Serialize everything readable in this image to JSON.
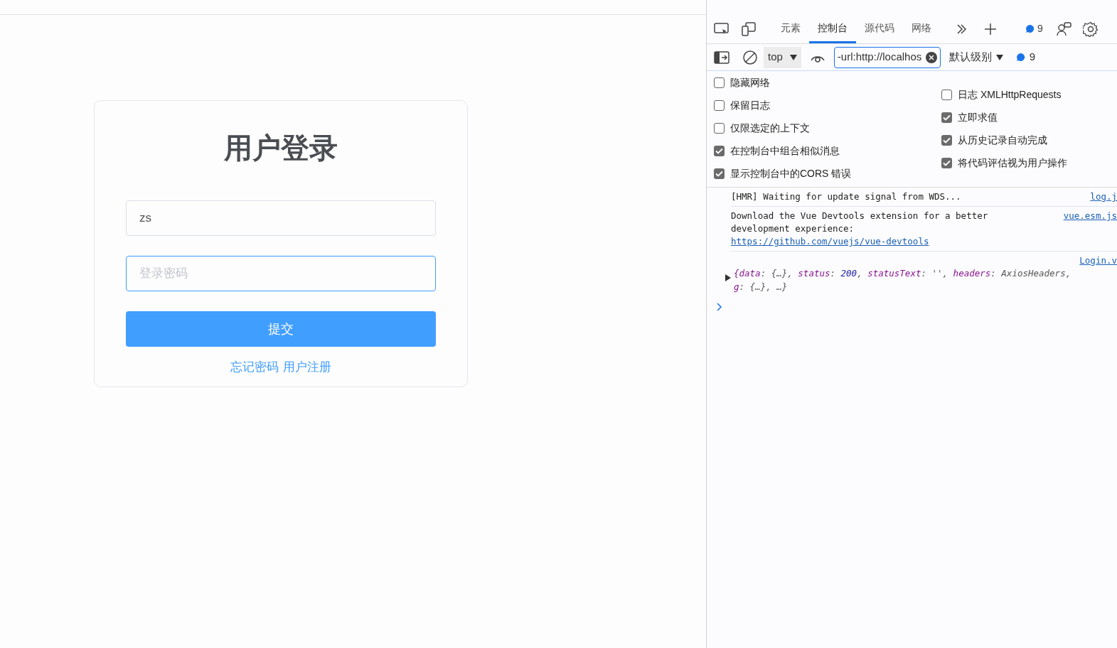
{
  "login": {
    "title": "用户登录",
    "username": {
      "value": "zs"
    },
    "password": {
      "placeholder": "登录密码",
      "focused": true
    },
    "submit": "提交",
    "links": [
      "忘记密码",
      "用户注册"
    ]
  },
  "devtools": {
    "tabs": [
      {
        "label": "元素",
        "selected": false
      },
      {
        "label": "控制台",
        "selected": true
      },
      {
        "label": "源代码",
        "selected": false
      },
      {
        "label": "网络",
        "selected": false
      }
    ],
    "issues_count": "9",
    "toolbar": {
      "context": "top",
      "filter": {
        "value": "-url:http://localhos"
      },
      "level": "默认级别",
      "messages_count": "9"
    },
    "settings_left": [
      {
        "label": "隐藏网络",
        "checked": false
      },
      {
        "label": "保留日志",
        "checked": false
      },
      {
        "label": "仅限选定的上下文",
        "checked": false
      },
      {
        "label": "在控制台中组合相似消息",
        "checked": true
      },
      {
        "label": "显示控制台中的CORS 错误",
        "checked": true
      }
    ],
    "settings_right": [
      {
        "label": "日志 XMLHttpRequests",
        "checked": false
      },
      {
        "label": "立即求值",
        "checked": true
      },
      {
        "label": "从历史记录自动完成",
        "checked": true
      },
      {
        "label": "将代码评估视为用户操作",
        "checked": true
      }
    ],
    "messages": [
      {
        "kind": "text",
        "lines": [
          "[HMR] Waiting for update signal from WDS..."
        ],
        "source": "log.j"
      },
      {
        "kind": "text",
        "lines": [
          "Download the Vue Devtools extension for a better",
          "development experience:"
        ],
        "link": "https://github.com/vuejs/vue-devtools",
        "source": "vue.esm.js"
      },
      {
        "kind": "object",
        "source": "Login.v",
        "rows": [
          [
            {
              "kind": "key",
              "text": "{data"
            },
            {
              "kind": "punct",
              "text": ": {…}, "
            },
            {
              "kind": "key",
              "text": "status"
            },
            {
              "kind": "punct",
              "text": ": "
            },
            {
              "kind": "number",
              "text": "200"
            },
            {
              "kind": "punct",
              "text": ", "
            },
            {
              "kind": "key",
              "text": "statusText"
            },
            {
              "kind": "punct",
              "text": ": '', "
            },
            {
              "kind": "key",
              "text": "headers"
            },
            {
              "kind": "punct",
              "text": ": AxiosHeaders,"
            }
          ],
          [
            {
              "kind": "key",
              "text": "g"
            },
            {
              "kind": "punct",
              "text": ": {…}, …}"
            }
          ]
        ]
      }
    ]
  }
}
